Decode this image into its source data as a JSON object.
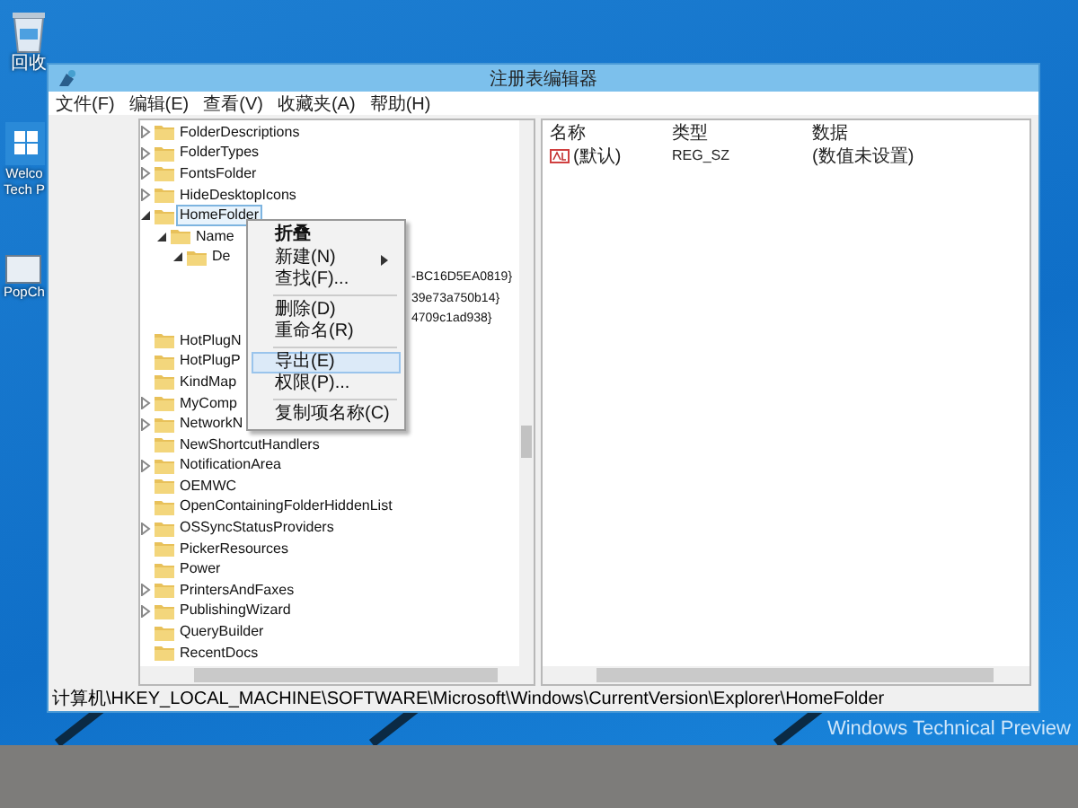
{
  "desktop": {
    "icons": [
      {
        "kind": "recycle",
        "label": "回收"
      },
      {
        "kind": "tile",
        "label": "Welco Tech P"
      },
      {
        "kind": "app",
        "label": "PopCh"
      }
    ],
    "watermark_text": "Windows Technical Preview"
  },
  "window": {
    "title": "注册表编辑器"
  },
  "menu_bar": [
    "文件(F)",
    "编辑(E)",
    "查看(V)",
    "收藏夹(A)",
    "帮助(H)"
  ],
  "tree": [
    {
      "kind": "branch",
      "label": "FolderDescriptions",
      "expanded": false,
      "selected": false
    },
    {
      "kind": "branch",
      "label": "FolderTypes",
      "expanded": false,
      "selected": false
    },
    {
      "kind": "branch",
      "label": "FontsFolder",
      "expanded": false,
      "selected": false
    },
    {
      "kind": "branch",
      "label": "HideDesktopIcons",
      "expanded": false,
      "selected": false
    },
    {
      "kind": "branch",
      "label": "HomeFolder",
      "expanded": true,
      "selected": true,
      "children": [
        {
          "kind": "branch",
          "label": "Name",
          "expanded": true,
          "selected": false,
          "children": [
            {
              "kind": "branch",
              "label": "De",
              "expanded": true,
              "selected": false,
              "children": [
                {
                  "kind": "fragment",
                  "label": "-BC16D5EA0819}",
                  "selected": false
                },
                {
                  "kind": "fragment",
                  "label": "39e73a750b14}",
                  "selected": false
                },
                {
                  "kind": "fragment",
                  "label": "4709c1ad938}",
                  "selected": false
                }
              ]
            }
          ]
        }
      ]
    },
    {
      "kind": "leaf",
      "label": "HotPlugN",
      "selected": false
    },
    {
      "kind": "leaf",
      "label": "HotPlugP",
      "selected": false
    },
    {
      "kind": "leaf",
      "label": "KindMap",
      "selected": false
    },
    {
      "kind": "branch",
      "label": "MyComp",
      "expanded": false,
      "selected": false
    },
    {
      "kind": "branch",
      "label": "NetworkN",
      "expanded": false,
      "selected": false
    },
    {
      "kind": "leaf",
      "label": "NewShortcutHandlers",
      "selected": false
    },
    {
      "kind": "branch",
      "label": "NotificationArea",
      "expanded": false,
      "selected": false
    },
    {
      "kind": "leaf",
      "label": "OEMWC",
      "selected": false
    },
    {
      "kind": "leaf",
      "label": "OpenContainingFolderHiddenList",
      "selected": false
    },
    {
      "kind": "branch",
      "label": "OSSyncStatusProviders",
      "expanded": false,
      "selected": false
    },
    {
      "kind": "leaf",
      "label": "PickerResources",
      "selected": false
    },
    {
      "kind": "leaf",
      "label": "Power",
      "selected": false
    },
    {
      "kind": "branch",
      "label": "PrintersAndFaxes",
      "expanded": false,
      "selected": false
    },
    {
      "kind": "branch",
      "label": "PublishingWizard",
      "expanded": false,
      "selected": false
    },
    {
      "kind": "leaf",
      "label": "QueryBuilder",
      "selected": false
    },
    {
      "kind": "leaf",
      "label": "RecentDocs",
      "selected": false
    }
  ],
  "context_menu": [
    {
      "kind": "item",
      "label": "折叠",
      "submenu": false,
      "selected": false,
      "bold": true
    },
    {
      "kind": "item",
      "label": "新建(N)",
      "submenu": true,
      "selected": false,
      "bold": false
    },
    {
      "kind": "item",
      "label": "查找(F)...",
      "submenu": false,
      "selected": false,
      "bold": false
    },
    {
      "kind": "separator"
    },
    {
      "kind": "item",
      "label": "删除(D)",
      "submenu": false,
      "selected": false,
      "bold": false
    },
    {
      "kind": "item",
      "label": "重命名(R)",
      "submenu": false,
      "selected": false,
      "bold": false
    },
    {
      "kind": "separator"
    },
    {
      "kind": "item",
      "label": "导出(E)",
      "submenu": false,
      "selected": true,
      "bold": false
    },
    {
      "kind": "item",
      "label": "权限(P)...",
      "submenu": false,
      "selected": false,
      "bold": false
    },
    {
      "kind": "separator"
    },
    {
      "kind": "item",
      "label": "复制项名称(C)",
      "submenu": false,
      "selected": false,
      "bold": false
    }
  ],
  "values_table": {
    "columns": [
      "名称",
      "类型",
      "数据"
    ],
    "rows": [
      {
        "name": "(默认)",
        "type": "REG_SZ",
        "data": "(数值未设置)"
      }
    ]
  },
  "status_bar": "计算机\\HKEY_LOCAL_MACHINE\\SOFTWARE\\Microsoft\\Windows\\CurrentVersion\\Explorer\\HomeFolder"
}
